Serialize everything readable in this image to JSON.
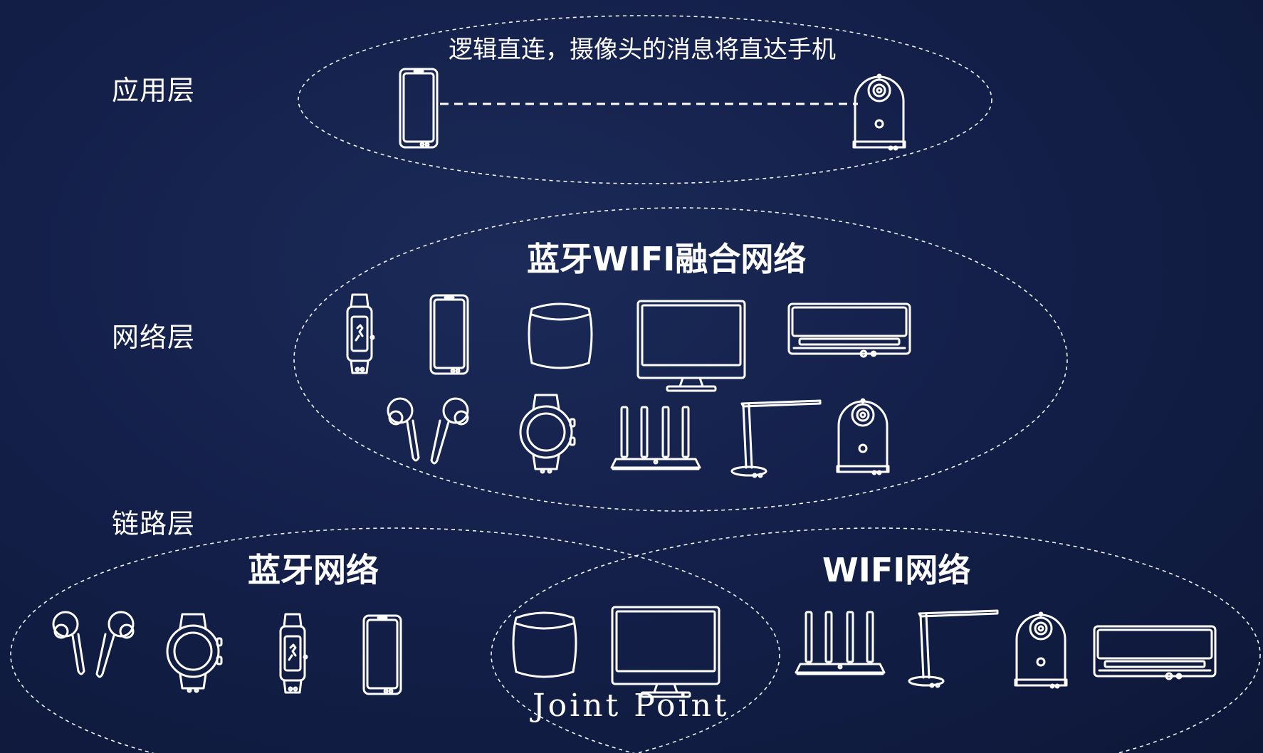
{
  "layers": {
    "application": "应用层",
    "network": "网络层",
    "link": "链路层"
  },
  "titles": {
    "application_note": "逻辑直连，摄像头的消息将直达手机",
    "fused_network": "蓝牙WIFI融合网络",
    "bluetooth_network": "蓝牙网络",
    "wifi_network": "WIFI网络",
    "joint_point": "Joint Point"
  },
  "colors": {
    "background": "#14204a",
    "line": "#ffffff"
  },
  "groups": {
    "application": [
      "phone",
      "camera"
    ],
    "fused_row1": [
      "band",
      "phone",
      "smart-speaker",
      "monitor",
      "air-conditioner"
    ],
    "fused_row2": [
      "earbuds",
      "smartwatch",
      "router",
      "desk-lamp",
      "camera"
    ],
    "bluetooth": [
      "earbuds",
      "smartwatch",
      "band",
      "phone"
    ],
    "joint": [
      "smart-speaker",
      "monitor"
    ],
    "wifi": [
      "router",
      "desk-lamp",
      "camera",
      "air-conditioner"
    ]
  }
}
